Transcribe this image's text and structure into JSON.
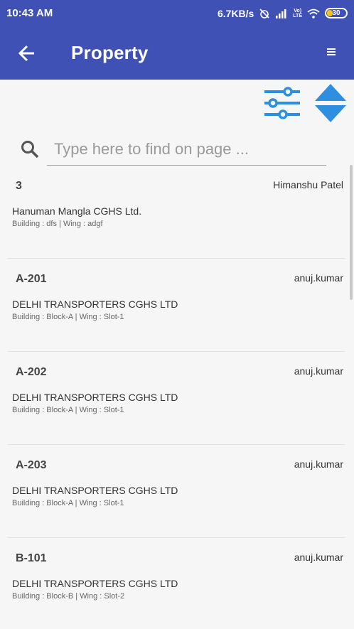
{
  "status_bar": {
    "time": "10:43 AM",
    "network_speed": "6.7KB/s",
    "volte": "Vo)\nLTE",
    "battery": "30"
  },
  "toolbar": {
    "title": "Property",
    "back_icon": "arrow-left-icon",
    "menu_icon": "menu-icon"
  },
  "actions": {
    "filter_icon": "filter-sliders-icon",
    "sort_icon": "sort-arrows-icon",
    "accent_color": "#2e8fe0"
  },
  "search": {
    "placeholder": "Type here to find on page ...",
    "value": ""
  },
  "colors": {
    "primary": "#3f51b5",
    "background": "#f6f6f6"
  },
  "properties": [
    {
      "code": "3",
      "user": "Himanshu Patel",
      "society": "Hanuman Mangla CGHS Ltd.",
      "detail": "Building : dfs | Wing : adgf"
    },
    {
      "code": "A-201",
      "user": "anuj.kumar",
      "society": "DELHI TRANSPORTERS CGHS LTD",
      "detail": "Building : Block-A | Wing : Slot-1"
    },
    {
      "code": "A-202",
      "user": "anuj.kumar",
      "society": "DELHI TRANSPORTERS CGHS LTD",
      "detail": "Building : Block-A | Wing : Slot-1"
    },
    {
      "code": "A-203",
      "user": "anuj.kumar",
      "society": "DELHI TRANSPORTERS CGHS LTD",
      "detail": "Building : Block-A | Wing : Slot-1"
    },
    {
      "code": "B-101",
      "user": "anuj.kumar",
      "society": "DELHI TRANSPORTERS CGHS LTD",
      "detail": "Building : Block-B | Wing : Slot-2"
    }
  ]
}
